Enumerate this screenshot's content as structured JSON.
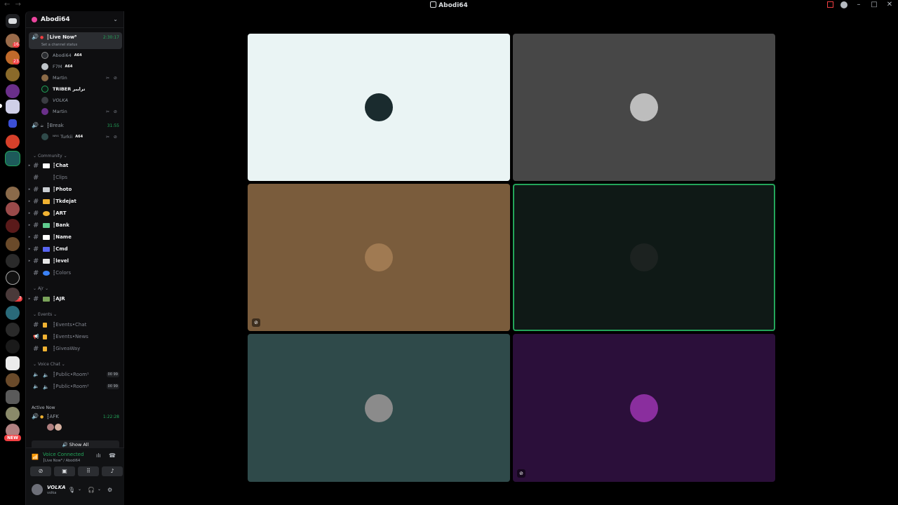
{
  "window": {
    "title": "Abodi64"
  },
  "guild": {
    "name": "Abodi64"
  },
  "voice_channels_top": [
    {
      "name": "┇Live Now⁸",
      "timer": "2:30:17",
      "status_placeholder": "Set a channel status",
      "users": [
        {
          "name": "Abodi64",
          "tag": "A64",
          "color": "#2b2d31"
        },
        {
          "name": "F7M",
          "tag": "A64",
          "color": "#bfc4c9"
        },
        {
          "name": "Martin",
          "tag": "",
          "color": "#8b6a47"
        },
        {
          "name": "TRIBER ترايبر",
          "tag": "",
          "color": "#0b1a14"
        },
        {
          "name": "VOLKA",
          "tag": "",
          "color": "#3a3c42"
        },
        {
          "name": "Martin",
          "tag": "",
          "color": "#6a2f8a"
        }
      ]
    },
    {
      "name": "┇Break",
      "timer": "31:55",
      "users": [
        {
          "name": "ᴺᴿᴳ Turkii",
          "tag": "A64",
          "color": "#2f4a4a"
        }
      ]
    }
  ],
  "categories": {
    "community": "Community",
    "ajr": "Ajr",
    "events": "Events",
    "voice_chat": "Voice Chat"
  },
  "text_channels": [
    {
      "name": "┇Chat",
      "muted": false,
      "emoji": "#ffffff"
    },
    {
      "name": "┇Clips",
      "muted": true,
      "emoji": "#5865f2"
    },
    {
      "name": "┇Photo",
      "muted": false,
      "emoji": "#c9cdd2"
    },
    {
      "name": "┇Tkdejat",
      "muted": false,
      "emoji": "#f0b232"
    },
    {
      "name": "┇ART",
      "muted": false,
      "emoji": "#f0b232"
    },
    {
      "name": "┇Bank",
      "muted": false,
      "emoji": "#5ecb8e"
    },
    {
      "name": "┇Name",
      "muted": false,
      "emoji": "#ffffff"
    },
    {
      "name": "┇Cmd",
      "muted": false,
      "emoji": "#5865f2"
    },
    {
      "name": "┇level",
      "muted": false,
      "emoji": "#e6e6e6"
    },
    {
      "name": "┇Colors",
      "muted": true,
      "emoji": "#3b82f6"
    }
  ],
  "ajr_channels": [
    {
      "name": "┇AJR",
      "muted": false,
      "emoji": "#7aa35a"
    }
  ],
  "event_channels": [
    {
      "name": "┇Events•Chat",
      "muted": true
    },
    {
      "name": "┇Events•News",
      "muted": true
    },
    {
      "name": "┇GiveaWay",
      "muted": true
    }
  ],
  "voice_chat_channels": [
    {
      "name": "┇Public•Room¹",
      "counter": "00 99"
    },
    {
      "name": "┇Public•Room²",
      "counter": "00 99"
    }
  ],
  "active_now": {
    "label": "Active Now",
    "channel": "┇AFK",
    "timer": "1:22:28",
    "show_all": "Show All"
  },
  "voice_panel": {
    "status": "Voice Connected",
    "location": "┇Live Now⁸ / Abodi64"
  },
  "user_panel": {
    "name": "VOLKA",
    "status": "volka"
  },
  "tiles": [
    {
      "bg": "#eaf4f4",
      "avatar": "#1a2b2e",
      "speaking": false,
      "muted_icon": false
    },
    {
      "bg": "#474747",
      "avatar": "#bdbdbd",
      "speaking": false,
      "muted_icon": false
    },
    {
      "bg": "#7a5c3c",
      "avatar": "#a07a52",
      "speaking": false,
      "muted_icon": true
    },
    {
      "bg": "#0f1916",
      "avatar": "#1c2220",
      "speaking": true,
      "muted_icon": false
    },
    {
      "bg": "#2f4a4a",
      "avatar": "#8b8b8b",
      "speaking": false,
      "muted_icon": false
    },
    {
      "bg": "#2b0f3a",
      "avatar": "#8a2e9e",
      "speaking": false,
      "muted_icon": true
    }
  ]
}
